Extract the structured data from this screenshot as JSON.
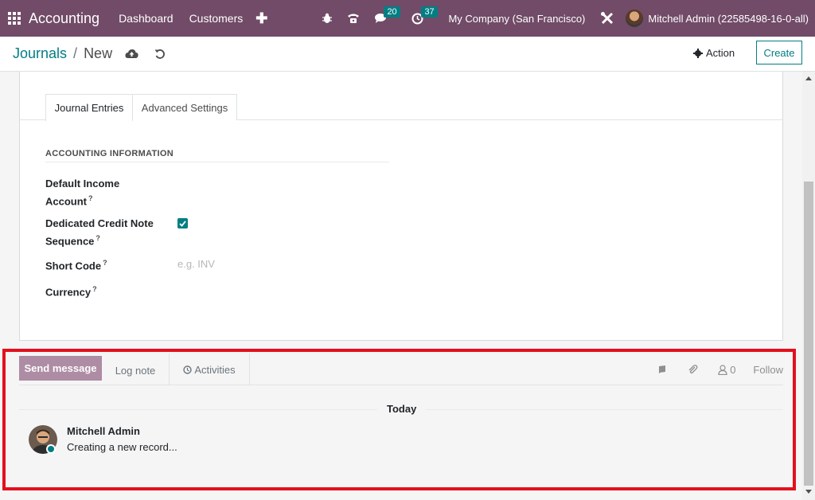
{
  "navbar": {
    "app_name": "Accounting",
    "menu": [
      "Dashboard",
      "Customers"
    ],
    "plus_label": "✚",
    "messages_count": "20",
    "activities_count": "37",
    "company": "My Company (San Francisco)",
    "user": "Mitchell Admin (22585498-16-0-all)"
  },
  "control_panel": {
    "breadcrumb_parent": "Journals",
    "breadcrumb_separator": "/",
    "breadcrumb_current": "New",
    "action_label": "Action",
    "create_label": "Create"
  },
  "form": {
    "tabs": [
      "Journal Entries",
      "Advanced Settings"
    ],
    "section_title": "ACCOUNTING INFORMATION",
    "fields": {
      "default_income_line1": "Default Income",
      "default_income_line2": "Account",
      "credit_note_line1": "Dedicated Credit Note",
      "credit_note_line2": "Sequence",
      "short_code": "Short Code",
      "short_code_placeholder": "e.g. INV",
      "currency": "Currency",
      "help_mark": "?"
    },
    "dedicated_credit_note_checked": true
  },
  "chatter": {
    "send_message": "Send message",
    "log_note": "Log note",
    "activities": "Activities",
    "followers_count": "0",
    "follow": "Follow",
    "date_separator": "Today",
    "message_author": "Mitchell Admin",
    "message_body": "Creating a new record..."
  },
  "colors": {
    "navbar": "#714b67",
    "accent": "#017e84",
    "send_button": "#a17a97",
    "highlight": "#e3101d"
  }
}
